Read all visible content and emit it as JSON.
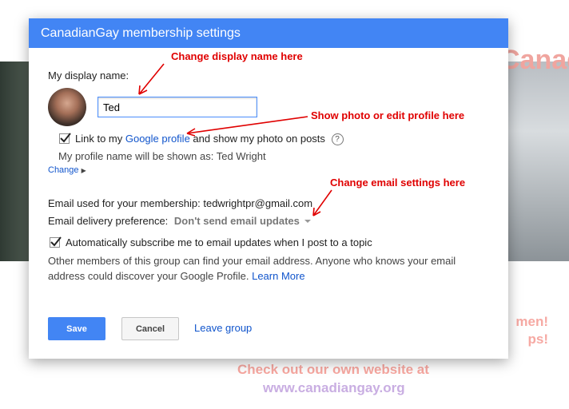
{
  "background": {
    "banner_title": "Canadi",
    "promo_right_line1": "men!",
    "promo_right_line2": "ps!",
    "promo_line1": "Check out our own website at",
    "promo_line2": "www.canadiangay.org"
  },
  "dialog": {
    "title": "CanadianGay membership settings",
    "display_name_label": "My display name:",
    "display_name_value": "Ted",
    "link_text_before": "Link to my ",
    "link_text_link": "Google profile",
    "link_text_after": " and show my photo on posts",
    "help_glyph": "?",
    "profile_name_text": "My profile name will be shown as: Ted Wright",
    "change_label": "Change",
    "email_text": "Email used for your membership: tedwrightpr@gmail.com",
    "delivery_label": "Email delivery preference:",
    "delivery_value": "Don't send email updates",
    "auto_subscribe_label": "Automatically subscribe me to email updates when I post to a topic",
    "note_text": "Other members of this group can find your email address. Anyone who knows your email address could discover your Google Profile.",
    "learn_more": "Learn More",
    "save_label": "Save",
    "cancel_label": "Cancel",
    "leave_label": "Leave group"
  },
  "annotations": {
    "display_name": "Change display name here",
    "photo": "Show photo or edit profile here",
    "email": "Change email settings here"
  },
  "colors": {
    "header": "#4285f4",
    "annotation": "#e00000",
    "link": "#1155cc"
  },
  "icons": [
    "checkmark-icon",
    "help-icon",
    "chevron-right-icon",
    "dropdown-caret-icon",
    "avatar"
  ]
}
